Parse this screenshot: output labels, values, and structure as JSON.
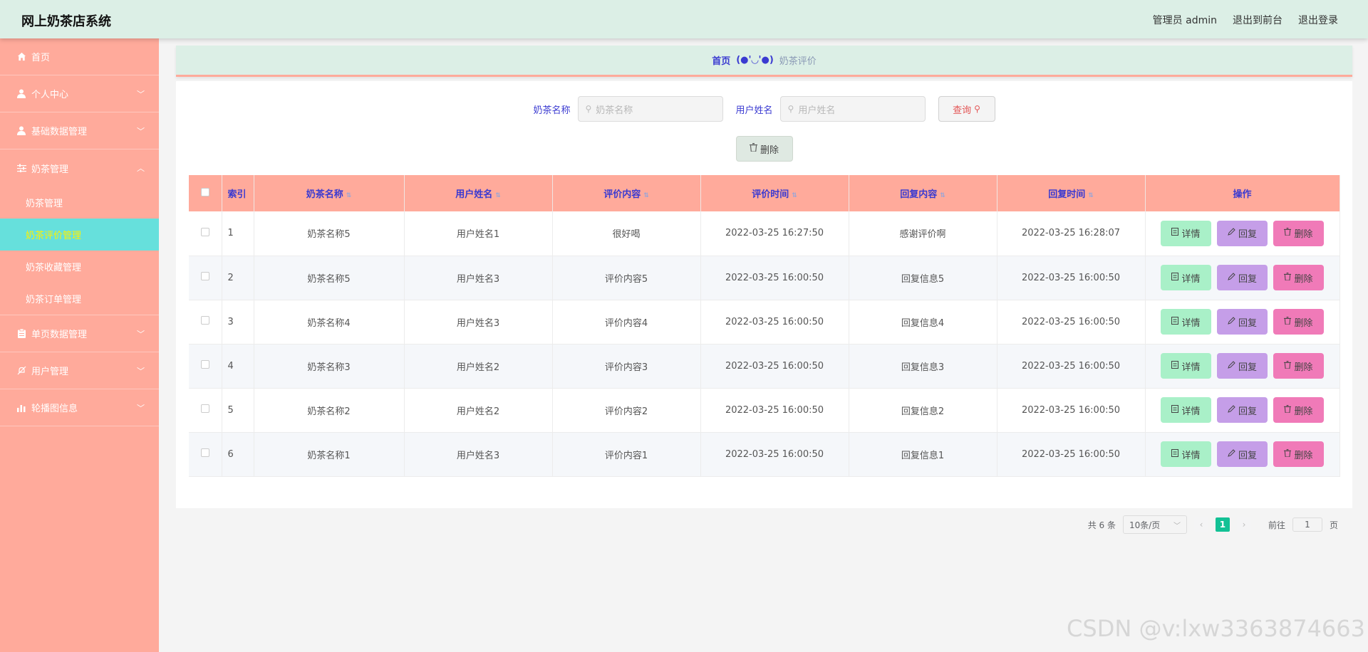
{
  "header": {
    "title": "网上奶茶店系统",
    "links": [
      "管理员 admin",
      "退出到前台",
      "退出登录"
    ]
  },
  "sidebar": {
    "items": [
      {
        "label": "首页",
        "icon": "home-icon"
      },
      {
        "label": "个人中心",
        "icon": "user-icon"
      },
      {
        "label": "基础数据管理",
        "icon": "user-icon"
      },
      {
        "label": "奶茶管理",
        "icon": "sliders-icon",
        "expanded": true,
        "children": [
          "奶茶管理",
          "奶茶评价管理",
          "奶茶收藏管理",
          "奶茶订单管理"
        ]
      },
      {
        "label": "单页数据管理",
        "icon": "clipboard-icon"
      },
      {
        "label": "用户管理",
        "icon": "bell-off-icon"
      },
      {
        "label": "轮播图信息",
        "icon": "bar-chart-icon"
      }
    ],
    "active_child": "奶茶评价管理"
  },
  "breadcrumb": {
    "home": "首页",
    "face": "(●'◡'●)",
    "current": "奶茶评价"
  },
  "search": {
    "field1_label": "奶茶名称",
    "field1_placeholder": "奶茶名称",
    "field2_label": "用户姓名",
    "field2_placeholder": "用户姓名",
    "query_label": "查询"
  },
  "toolbar": {
    "delete_label": "删除"
  },
  "table": {
    "headers": [
      "索引",
      "奶茶名称",
      "用户姓名",
      "评价内容",
      "评价时间",
      "回复内容",
      "回复时间",
      "操作"
    ],
    "rows": [
      {
        "idx": "1",
        "name": "奶茶名称5",
        "user": "用户姓名1",
        "content": "很好喝",
        "time": "2022-03-25 16:27:50",
        "reply": "感谢评价啊",
        "reply_time": "2022-03-25 16:28:07"
      },
      {
        "idx": "2",
        "name": "奶茶名称5",
        "user": "用户姓名3",
        "content": "评价内容5",
        "time": "2022-03-25 16:00:50",
        "reply": "回复信息5",
        "reply_time": "2022-03-25 16:00:50"
      },
      {
        "idx": "3",
        "name": "奶茶名称4",
        "user": "用户姓名3",
        "content": "评价内容4",
        "time": "2022-03-25 16:00:50",
        "reply": "回复信息4",
        "reply_time": "2022-03-25 16:00:50"
      },
      {
        "idx": "4",
        "name": "奶茶名称3",
        "user": "用户姓名2",
        "content": "评价内容3",
        "time": "2022-03-25 16:00:50",
        "reply": "回复信息3",
        "reply_time": "2022-03-25 16:00:50"
      },
      {
        "idx": "5",
        "name": "奶茶名称2",
        "user": "用户姓名2",
        "content": "评价内容2",
        "time": "2022-03-25 16:00:50",
        "reply": "回复信息2",
        "reply_time": "2022-03-25 16:00:50"
      },
      {
        "idx": "6",
        "name": "奶茶名称1",
        "user": "用户姓名3",
        "content": "评价内容1",
        "time": "2022-03-25 16:00:50",
        "reply": "回复信息1",
        "reply_time": "2022-03-25 16:00:50"
      }
    ],
    "actions": {
      "detail": "详情",
      "reply": "回复",
      "remove": "删除"
    }
  },
  "pager": {
    "total": "共 6 条",
    "page_size": "10条/页",
    "current_page": "1",
    "goto_prefix": "前往",
    "goto_value": "1",
    "goto_suffix": "页"
  },
  "watermark": "CSDN @v:lxw3363874663",
  "colors": {
    "header_bg": "#dcefe6",
    "sidebar_bg": "#ffaa9b",
    "active_bg": "#66e0dc",
    "accent_text": "#3a3ad1"
  }
}
